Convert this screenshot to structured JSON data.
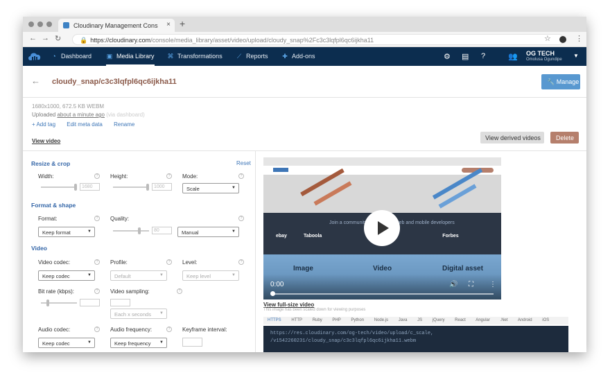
{
  "browser": {
    "tab_title": "Cloudinary Management Cons",
    "url_host": "https://cloudinary.com",
    "url_path": "/console/media_library/asset/video/upload/cloudy_snap%2Fc3c3lqfpl6qc6ijkha11"
  },
  "nav": {
    "items": [
      {
        "label": "Dashboard",
        "icon": "dashboard-icon"
      },
      {
        "label": "Media Library",
        "icon": "media-library-icon"
      },
      {
        "label": "Transformations",
        "icon": "transformations-icon"
      },
      {
        "label": "Reports",
        "icon": "reports-icon"
      },
      {
        "label": "Add-ons",
        "icon": "add-ons-icon"
      }
    ],
    "user_name": "OG TECH",
    "user_sub": "Omolusa Ogundipe"
  },
  "asset": {
    "title": "cloudy_snap/c3c3lqfpl6qc6ijkha11",
    "manage_label": "Manage",
    "meta_size": "1680x1000, 672.5 KB WEBM",
    "uploaded_prefix": "Uploaded ",
    "uploaded_time": "about a minute ago",
    "uploaded_suffix": " (via dashboard)",
    "links": [
      "+ Add tag",
      "Edit meta data",
      "Rename"
    ],
    "view_video": "View video",
    "view_derived": "View derived videos",
    "delete_label": "Delete"
  },
  "editor": {
    "resize_crop": "Resize & crop",
    "reset": "Reset",
    "width_label": "Width:",
    "width_value": "1680",
    "height_label": "Height:",
    "height_value": "1000",
    "mode_label": "Mode:",
    "mode_value": "Scale",
    "format_shape": "Format & shape",
    "format_label": "Format:",
    "format_value": "Keep format",
    "quality_label": "Quality:",
    "quality_value": "80",
    "quality_mode": "Manual",
    "video": "Video",
    "video_codec_label": "Video codec:",
    "video_codec_value": "Keep codec",
    "profile_label": "Profile:",
    "profile_value": "Default",
    "level_label": "Level:",
    "level_value": "Keep level",
    "bitrate_label": "Bit rate (kbps):",
    "video_sampling_label": "Video sampling:",
    "sampling_value": "Each x seconds",
    "audio_codec_label": "Audio codec:",
    "audio_codec_value": "Keep codec",
    "audio_freq_label": "Audio frequency:",
    "audio_freq_value": "Keep frequency",
    "keyframe_label": "Keyframe interval:"
  },
  "preview": {
    "time": "0:00",
    "overlay_words": [
      "Image",
      "Video",
      "Digital asset"
    ],
    "community_text": "Join a community of 400,000+ web and mobile developers",
    "brands": [
      "ebay",
      "Taboola",
      "Forbes"
    ],
    "full_size": "View full-size video",
    "scaled_note": "This image has been scaled down for viewing purposes",
    "code_tabs": [
      "HTTPS",
      "HTTP",
      "Ruby",
      "PHP",
      "Python",
      "Node.js",
      "Java",
      "JS",
      "jQuery",
      "React",
      "Angular",
      ".Net",
      "Android",
      "iOS"
    ],
    "code_line1": "https://res.cloudinary.com/og-tech/video/upload/c_scale,",
    "code_line2": "/v1542260231/cloudy_snap/c3c3lqfpl6qc6ijkha11.webm"
  }
}
